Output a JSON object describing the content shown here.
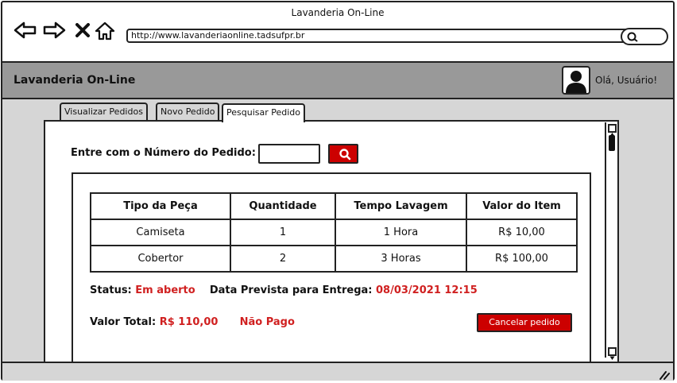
{
  "browser": {
    "window_title": "Lavanderia On-Line",
    "url": "http://www.lavanderiaonline.tadsufpr.br"
  },
  "header": {
    "app_title": "Lavanderia On-Line",
    "greeting": "Olá, Usuário!"
  },
  "tabs": [
    {
      "label": "Visualizar Pedidos",
      "active": false
    },
    {
      "label": "Novo Pedido",
      "active": false
    },
    {
      "label": "Pesquisar Pedido",
      "active": true
    }
  ],
  "search": {
    "label": "Entre com o Número do Pedido:",
    "value": ""
  },
  "table": {
    "headers": [
      "Tipo da Peça",
      "Quantidade",
      "Tempo Lavagem",
      "Valor do Item"
    ],
    "rows": [
      [
        "Camiseta",
        "1",
        "1  Hora",
        "R$ 10,00"
      ],
      [
        "Cobertor",
        "2",
        "3  Horas",
        "R$ 100,00"
      ]
    ]
  },
  "order": {
    "status_label": "Status:",
    "status_value": "Em aberto",
    "delivery_label": "Data Prevista para Entrega:",
    "delivery_value": "08/03/2021 12:15",
    "total_label": "Valor Total:",
    "total_value": "R$ 110,00",
    "payment_status": "Não Pago",
    "cancel_label": "Cancelar pedido"
  },
  "colors": {
    "accent_red": "#cc0000",
    "header_gray": "#999999",
    "content_gray": "#d6d6d6"
  },
  "icons": [
    "back-arrow-icon",
    "forward-arrow-icon",
    "close-icon",
    "home-icon",
    "search-icon",
    "user-avatar-icon",
    "resize-grip-icon"
  ]
}
